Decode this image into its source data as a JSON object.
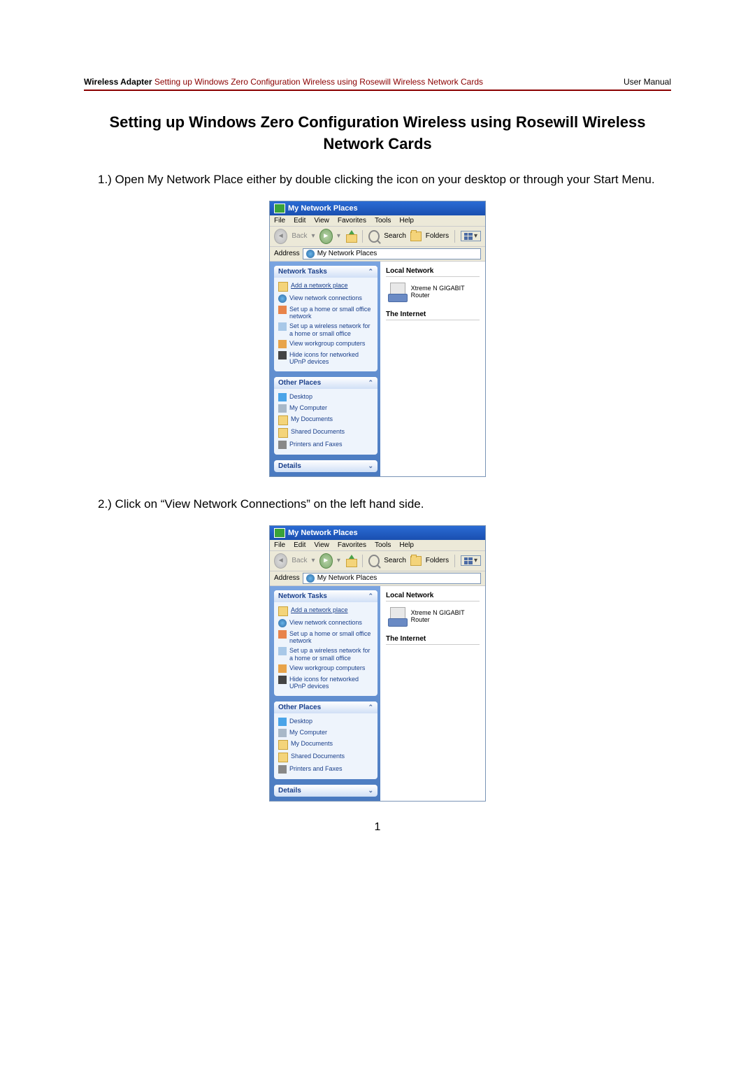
{
  "header": {
    "product": "Wireless Adapter",
    "topic": "Setting up Windows Zero Configuration Wireless using Rosewill Wireless Network Cards",
    "right": "User Manual"
  },
  "title": "Setting up Windows Zero Configuration Wireless using Rosewill Wireless Network Cards",
  "steps": {
    "s1": "1.) Open My Network Place either by double clicking the icon on your desktop or through your Start Menu.",
    "s2": "2.) Click on “View Network Connections” on the left hand side."
  },
  "win": {
    "title": "My Network Places",
    "menus": [
      "File",
      "Edit",
      "View",
      "Favorites",
      "Tools",
      "Help"
    ],
    "toolbar": {
      "back": "Back",
      "search": "Search",
      "folders": "Folders"
    },
    "address_label": "Address",
    "address_value": "My Network Places",
    "panels": {
      "tasks_title": "Network Tasks",
      "other_title": "Other Places",
      "details_title": "Details"
    },
    "tasks": [
      "Add a network place",
      "View network connections",
      "Set up a home or small office network",
      "Set up a wireless network for a home or small office",
      "View workgroup computers",
      "Hide icons for networked UPnP devices"
    ],
    "other_places": [
      "Desktop",
      "My Computer",
      "My Documents",
      "Shared Documents",
      "Printers and Faxes"
    ],
    "main": {
      "local_label": "Local Network",
      "router_label": "Xtreme N GIGABIT Router",
      "internet_label": "The Internet"
    }
  },
  "page_number": "1"
}
